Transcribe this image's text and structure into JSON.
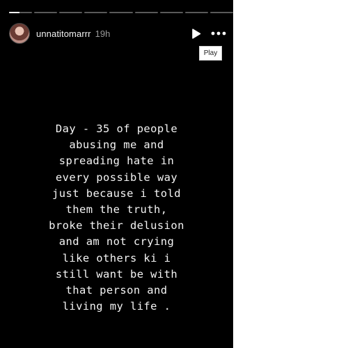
{
  "story": {
    "username": "unnatitomarrr",
    "timestamp": "19h",
    "progress": {
      "segment_count": 9,
      "current_index": 0,
      "current_fraction": 0.45
    },
    "controls": {
      "play_icon": "play-icon",
      "more_icon": "more-horizontal-icon",
      "tooltip": "Play"
    },
    "text_lines": [
      "Day - 35 of people",
      "abusing me and",
      "spreading hate in",
      "every possible way",
      "just because i told",
      "them the truth,",
      "broke their delusion",
      "and am not crying",
      "like others ki i",
      "still want be with",
      "that person and",
      "living my life ."
    ],
    "colors": {
      "background": "#000000",
      "text": "#f4f4f4",
      "timestamp": "#9a9a9a",
      "progress_track": "rgba(255,255,255,0.35)",
      "progress_fill": "#ffffff"
    }
  }
}
